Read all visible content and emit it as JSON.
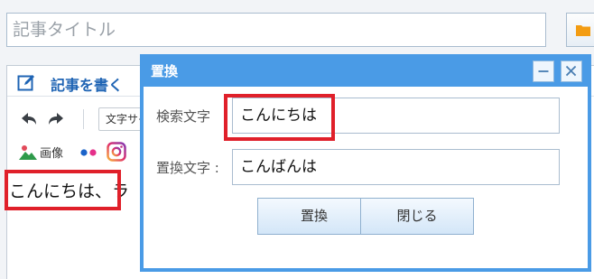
{
  "title_field": {
    "placeholder": "記事タイトル"
  },
  "folder_button": {
    "icon": "folder-icon"
  },
  "editor": {
    "header_title": "記事を書く",
    "font_size_select": "文字サイズ",
    "image_label": "画像",
    "body_text": "こんにちは、ラ"
  },
  "dialog": {
    "title": "置換",
    "search_label": "検索文字",
    "search_value": "こんにちは",
    "replace_label": "置換文字 :",
    "replace_value": "こんばんは",
    "replace_button": "置換",
    "close_button": "閉じる"
  },
  "colors": {
    "accent": "#4a9be6",
    "highlight": "#e0202a",
    "title_blue": "#1f64b4"
  }
}
